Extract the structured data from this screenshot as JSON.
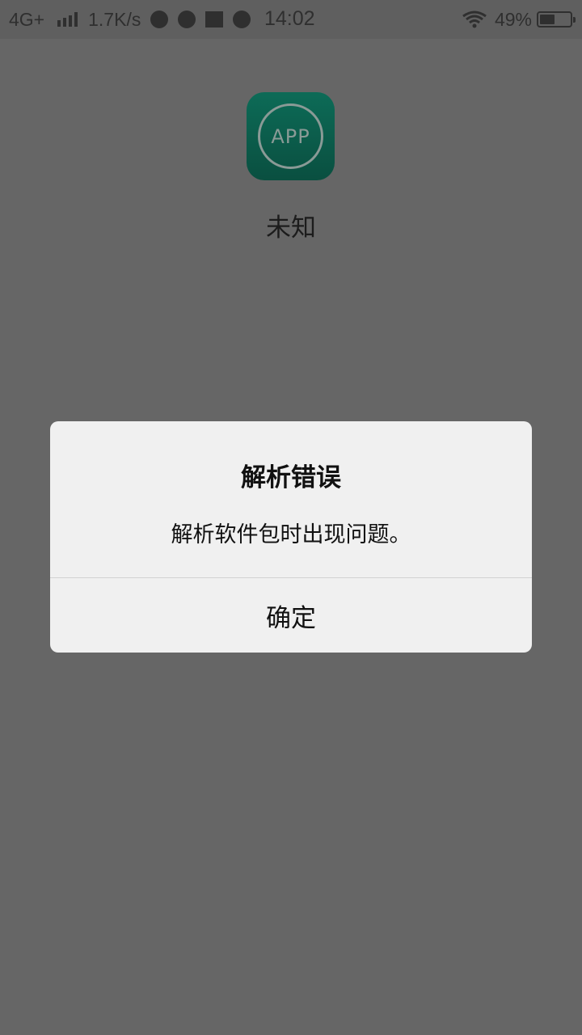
{
  "status_bar": {
    "network": "4G+",
    "speed": "1.7K/s",
    "time": "14:02",
    "battery": "49%",
    "battery_level": 0.49,
    "icons": [
      "signal-icon",
      "browser-icon",
      "game-icon",
      "image-icon",
      "check-icon",
      "wifi-icon",
      "battery-icon"
    ]
  },
  "app": {
    "icon_text": "APP",
    "name": "未知",
    "icon_color": "#0d6b57"
  },
  "dialog": {
    "title": "解析错误",
    "message": "解析软件包时出现问题。",
    "confirm_label": "确定"
  },
  "colors": {
    "overlay": "#666666",
    "dialog_bg": "#f0f0f0"
  }
}
